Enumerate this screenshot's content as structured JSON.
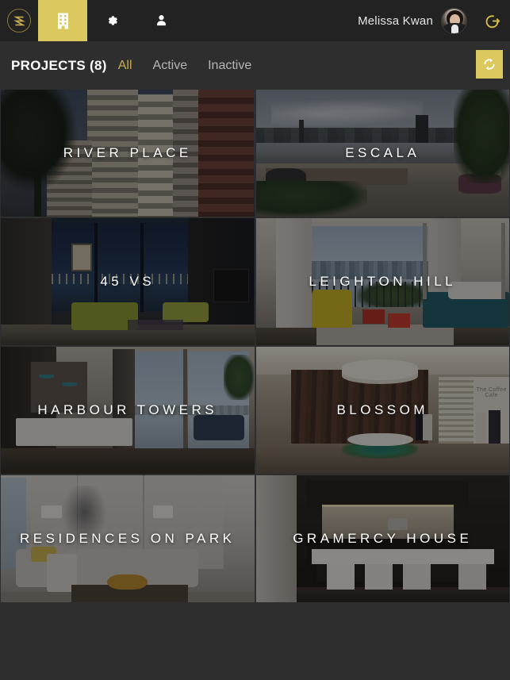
{
  "brand": {
    "logo_icon": "shuttle-s-logo-icon",
    "accent_gold": "#dbc95f",
    "accent_gold_text": "#c8ae49",
    "header_bg": "#222222",
    "page_bg": "#2e2e2e"
  },
  "header": {
    "nav": [
      {
        "id": "projects",
        "icon": "building-icon",
        "label": "Projects",
        "active": true
      },
      {
        "id": "settings",
        "icon": "gear-icon",
        "label": "Settings",
        "active": false
      },
      {
        "id": "account",
        "icon": "person-icon",
        "label": "Account",
        "active": false
      }
    ],
    "user_name": "Melissa Kwan",
    "avatar_icon": "user-avatar-photo",
    "logout_icon": "logout-arrow-icon",
    "logout_label": "Log out"
  },
  "toolbar": {
    "title": "PROJECTS (8)",
    "project_count": 8,
    "filters": [
      {
        "label": "All",
        "selected": true
      },
      {
        "label": "Active",
        "selected": false
      },
      {
        "label": "Inactive",
        "selected": false
      }
    ],
    "refresh_icon": "refresh-icon",
    "refresh_label": "Refresh"
  },
  "projects": [
    {
      "name": "RIVER PLACE",
      "scene": "s1"
    },
    {
      "name": "ESCALA",
      "scene": "s2"
    },
    {
      "name": "45 VS",
      "scene": "s3"
    },
    {
      "name": "LEIGHTON HILL",
      "scene": "s4"
    },
    {
      "name": "HARBOUR TOWERS",
      "scene": "s5"
    },
    {
      "name": "BLOSSOM",
      "scene": "s6",
      "sign_text": "The Coffee Cafe"
    },
    {
      "name": "RESIDENCES ON PARK",
      "scene": "s7"
    },
    {
      "name": "GRAMERCY HOUSE",
      "scene": "s8"
    }
  ]
}
